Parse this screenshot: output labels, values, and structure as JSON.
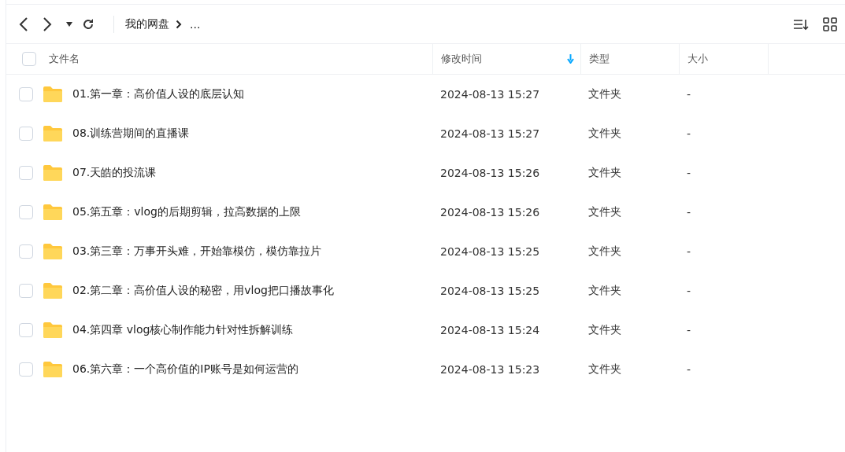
{
  "breadcrumb": [
    "我的网盘",
    "..."
  ],
  "columns": [
    {
      "label": "文件名",
      "sorted": false
    },
    {
      "label": "修改时间",
      "sorted": true
    },
    {
      "label": "类型",
      "sorted": false
    },
    {
      "label": "大小",
      "sorted": false
    }
  ],
  "header_checked": false,
  "rows": [
    {
      "name": "01.第一章：高价值人设的底层认知",
      "modified": "2024-08-13 15:27",
      "type": "文件夹",
      "size": "-",
      "checked": false
    },
    {
      "name": "08.训练营期间的直播课",
      "modified": "2024-08-13 15:27",
      "type": "文件夹",
      "size": "-",
      "checked": false
    },
    {
      "name": "07.天皓的投流课",
      "modified": "2024-08-13 15:26",
      "type": "文件夹",
      "size": "-",
      "checked": false
    },
    {
      "name": "05.第五章：vlog的后期剪辑，拉高数据的上限",
      "modified": "2024-08-13 15:26",
      "type": "文件夹",
      "size": "-",
      "checked": false
    },
    {
      "name": "03.第三章：万事开头难，开始靠模仿，模仿靠拉片",
      "modified": "2024-08-13 15:25",
      "type": "文件夹",
      "size": "-",
      "checked": false
    },
    {
      "name": "02.第二章：高价值人设的秘密，用vlog把口播故事化",
      "modified": "2024-08-13 15:25",
      "type": "文件夹",
      "size": "-",
      "checked": false
    },
    {
      "name": "04.第四章 vlog核心制作能力针对性拆解训练",
      "modified": "2024-08-13 15:24",
      "type": "文件夹",
      "size": "-",
      "checked": false
    },
    {
      "name": "06.第六章：一个高价值的IP账号是如何运营的",
      "modified": "2024-08-13 15:23",
      "type": "文件夹",
      "size": "-",
      "checked": false
    }
  ]
}
